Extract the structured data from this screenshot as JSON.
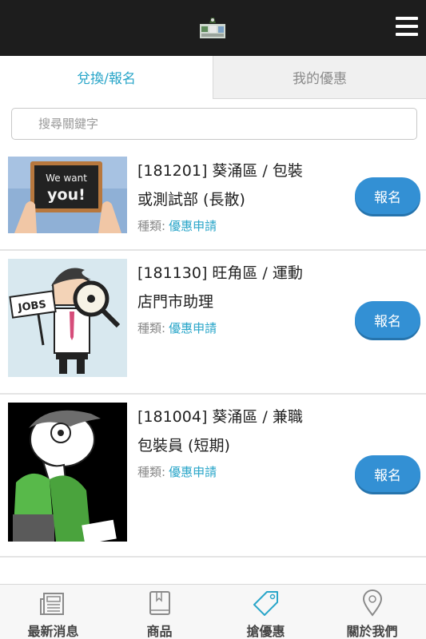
{
  "header": {
    "logo_icon": "app-logo-icon",
    "menu_icon": "hamburger-menu-icon"
  },
  "tabs": [
    {
      "label": "兌換/報名",
      "active": true
    },
    {
      "label": "我的優惠",
      "active": false
    }
  ],
  "search": {
    "placeholder": "搜尋關鍵字",
    "value": ""
  },
  "listings": [
    {
      "title_line1": "[181201] 葵涌區 / 包裝",
      "title_line2": "或測試部 (長散)",
      "category_label": "種類:",
      "category_value": "優惠申請",
      "button_label": "報名",
      "image_text_1": "We want",
      "image_text_2": "you!"
    },
    {
      "title_line1": "[181130] 旺角區 / 運動",
      "title_line2": "店門市助理",
      "category_label": "種類:",
      "category_value": "優惠申請",
      "button_label": "報名",
      "image_text_1": "JOBS"
    },
    {
      "title_line1": "[181004] 葵涌區 / 兼職",
      "title_line2": "包裝員 (短期)",
      "category_label": "種類:",
      "category_value": "優惠申請",
      "button_label": "報名"
    }
  ],
  "bottom_nav": [
    {
      "label": "最新消息",
      "icon": "newspaper-icon"
    },
    {
      "label": "商品",
      "icon": "book-icon"
    },
    {
      "label": "搶優惠",
      "icon": "tag-icon"
    },
    {
      "label": "關於我們",
      "icon": "map-pin-icon"
    }
  ],
  "colors": {
    "accent": "#2aa6c9",
    "button": "#3390d4",
    "header_bg": "#1d1d1d"
  }
}
